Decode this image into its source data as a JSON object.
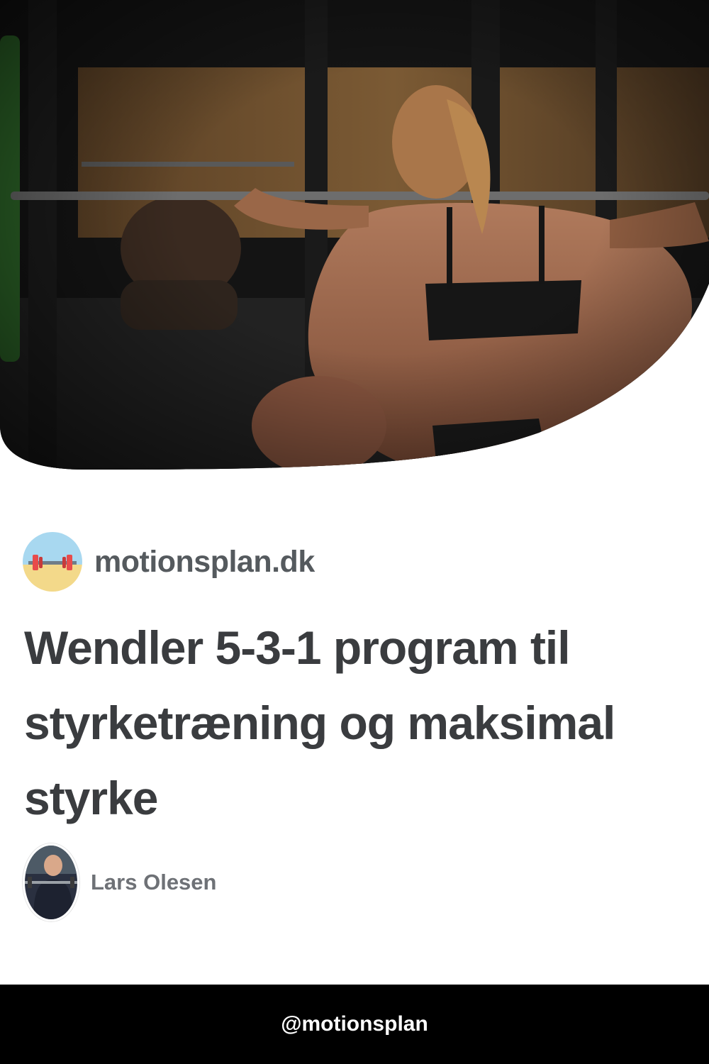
{
  "brand": {
    "name": "motionsplan.dk",
    "logo_icon": "barbell-icon"
  },
  "article": {
    "title": "Wendler 5-3-1 program til styrketræning og maksimal styrke"
  },
  "author": {
    "name": "Lars Olesen",
    "avatar_icon": "author-photo-icon"
  },
  "footer": {
    "handle": "@motionsplan"
  },
  "colors": {
    "title": "#3a3c3f",
    "brand_text": "#555a5e",
    "author_text": "#6e7176",
    "footer_bg": "#000000",
    "logo_sky": "#a8d8f0",
    "logo_sand": "#f3d98a",
    "plate_red": "#e84b4b"
  }
}
